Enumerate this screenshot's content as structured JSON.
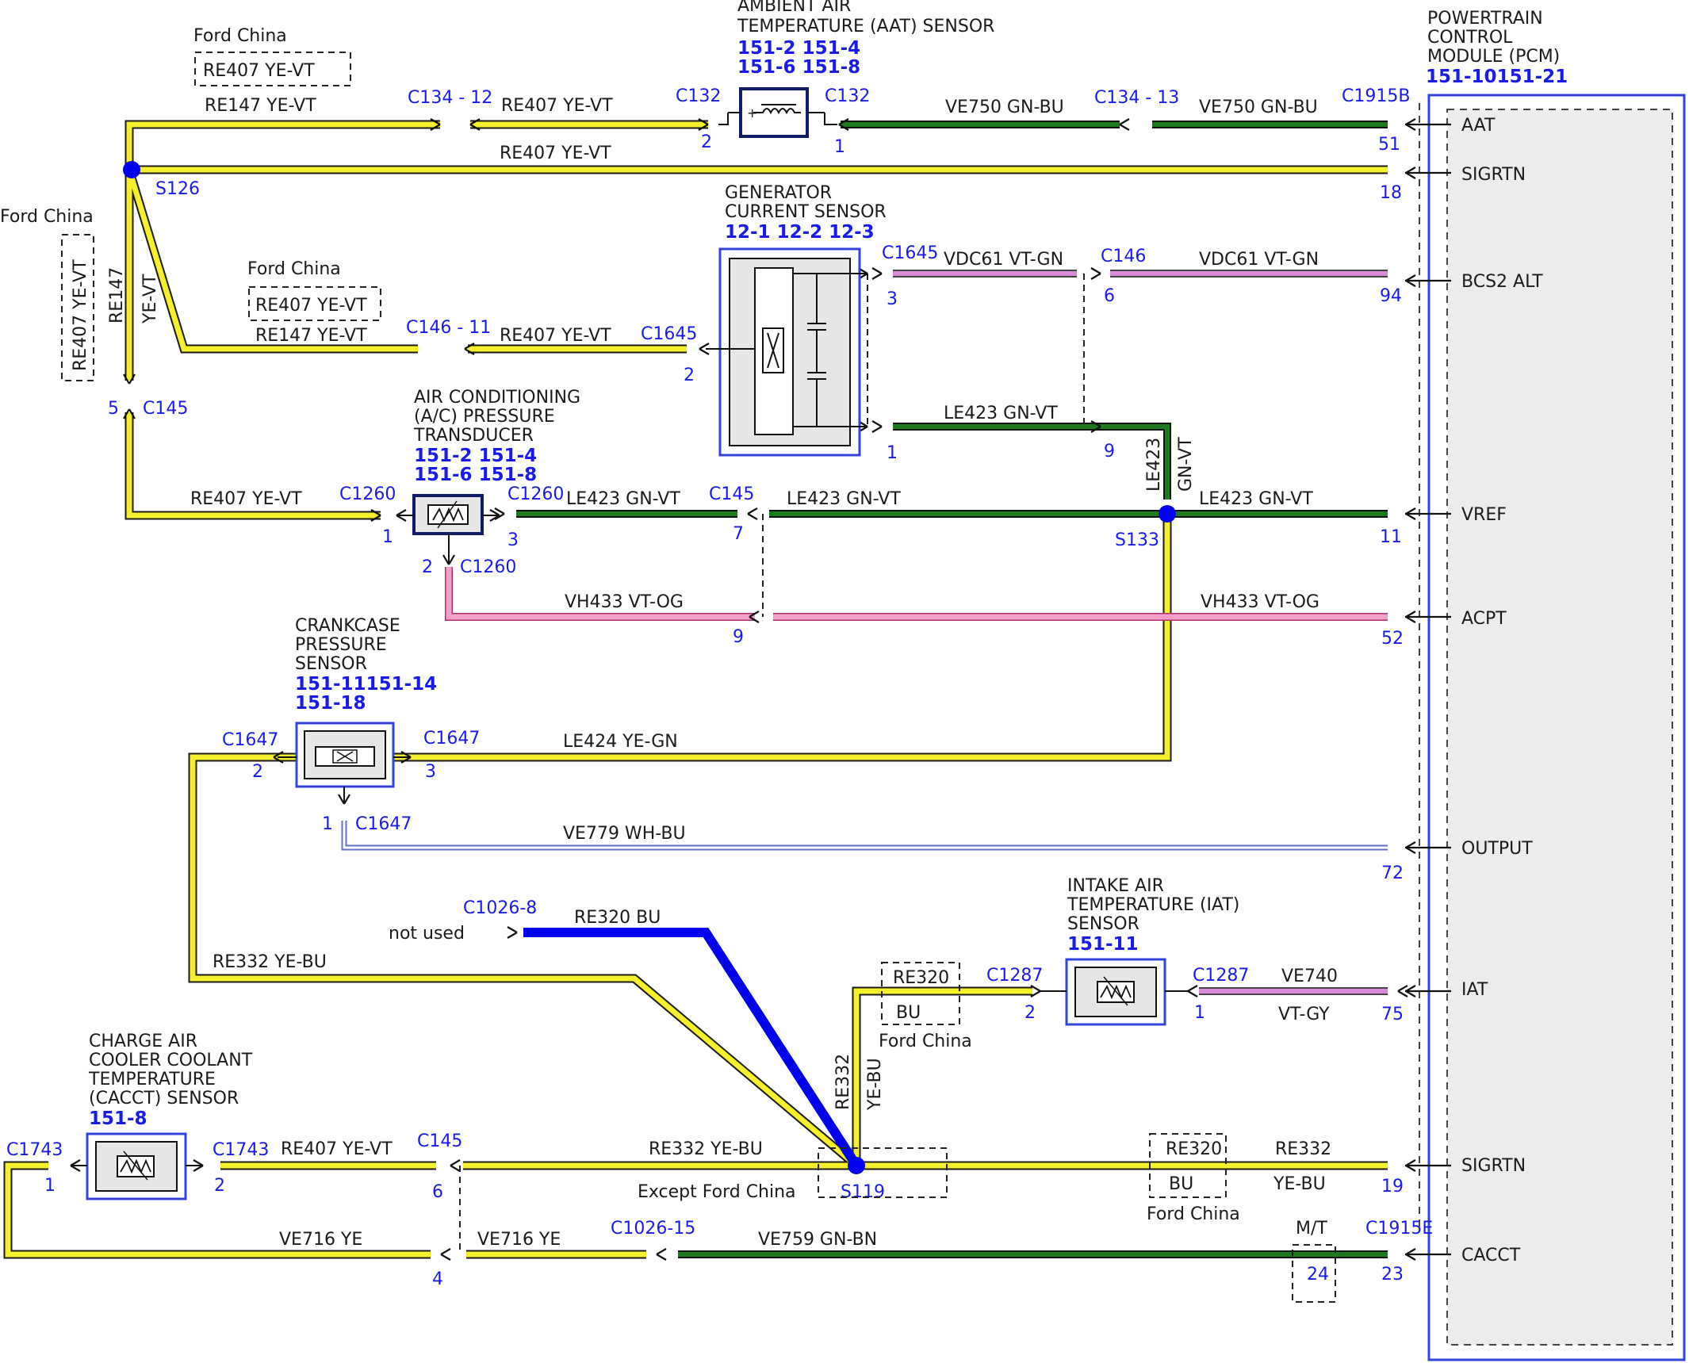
{
  "pcm": {
    "title": [
      "POWERTRAIN",
      "CONTROL",
      "MODULE (PCM)"
    ],
    "refs": "151-10151-21",
    "connector": "C1915B",
    "connector2": "C1915E",
    "pins": [
      {
        "name": "AAT",
        "pin": "51"
      },
      {
        "name": "SIGRTN",
        "pin": "18"
      },
      {
        "name": "BCS2 ALT",
        "pin": "94"
      },
      {
        "name": "VREF",
        "pin": "11"
      },
      {
        "name": "ACPT",
        "pin": "52"
      },
      {
        "name": "OUTPUT",
        "pin": "72"
      },
      {
        "name": "IAT",
        "pin": "75"
      },
      {
        "name": "SIGRTN",
        "pin": "19"
      },
      {
        "name": "CACCT",
        "pin": "23"
      }
    ]
  },
  "components": {
    "aat": {
      "title": [
        "AMBIENT AIR",
        "TEMPERATURE (AAT) SENSOR"
      ],
      "refs": [
        "151-2 151-4",
        "151-6 151-8"
      ],
      "conn_left": "C132",
      "conn_right": "C132",
      "pin_left": "2",
      "pin_right": "1"
    },
    "gen": {
      "title": [
        "GENERATOR",
        "CURRENT SENSOR"
      ],
      "refs": "12-1  12-2  12-3",
      "conn_a": "C1645",
      "conn_b": "C1645",
      "pin_3": "3",
      "pin_1": "1",
      "pin_2": "2"
    },
    "acpt": {
      "title": [
        "AIR CONDITIONING",
        "(A/C) PRESSURE",
        "TRANSDUCER"
      ],
      "refs": [
        "151-2 151-4",
        "151-6 151-8"
      ],
      "conn_left": "C1260",
      "conn_right": "C1260",
      "conn_bottom": "C1260",
      "pin_1": "1",
      "pin_3": "3",
      "pin_2": "2"
    },
    "ccp": {
      "title": [
        "CRANKCASE",
        "PRESSURE",
        "SENSOR"
      ],
      "refs": [
        "151-11151-14",
        "151-18"
      ],
      "conn_left": "C1647",
      "conn_right": "C1647",
      "conn_bottom": "C1647",
      "pin_2": "2",
      "pin_3": "3",
      "pin_1": "1"
    },
    "iat": {
      "title": [
        "INTAKE AIR",
        "TEMPERATURE (IAT)",
        "SENSOR"
      ],
      "refs": "151-11",
      "conn_left": "C1287",
      "conn_right": "C1287",
      "pin_2": "2",
      "pin_1": "1"
    },
    "cacct": {
      "title": [
        "CHARGE AIR",
        "COOLER COOLANT",
        "TEMPERATURE",
        "(CACCT) SENSOR"
      ],
      "refs": "151-8",
      "conn_left": "C1743",
      "conn_right": "C1743",
      "pin_1": "1",
      "pin_2": "2"
    }
  },
  "connectors": {
    "c134_12": "C134 - 12",
    "c134_13": "C134 - 13",
    "c146_11": "C146 - 11",
    "c146": "C146",
    "c146_pin6": "6",
    "c146_pin9": "9",
    "c145_top": "C145",
    "c145_top_pin": "5",
    "c145_mid": "C145",
    "c145_mid_pin7": "7",
    "c145_mid_pin9": "9",
    "c145_bot": "C145",
    "c145_bot_pin6": "6",
    "c145_bot_pin4": "4",
    "c1026_8": "C1026-8",
    "c1026_15": "C1026-15",
    "mt": "M/T",
    "mt_pin": "24"
  },
  "splices": {
    "s126": "S126",
    "s133": "S133",
    "s119": "S119"
  },
  "wires": {
    "re147_top": "RE147   YE-VT",
    "re407_top": "RE407   YE-VT",
    "re407_box": "RE407   YE-VT",
    "ve750_a": "VE750   GN-BU",
    "ve750_b": "VE750   GN-BU",
    "re407_sigrtn": "RE407   YE-VT",
    "re147_vert_a": "RE147",
    "re147_vert_b": "YE-VT",
    "re407_vert_box": "RE407  YE-VT",
    "re407_box2": "RE407  YE-VT",
    "re147_mid": "RE147   YE-VT",
    "re407_mid": "RE407    YE-VT",
    "vdc61_a": "VDC61    VT-GN",
    "vdc61_b": "VDC61    VT-GN",
    "le423_a": "LE423     GN-VT",
    "le423_vert_a": "LE423",
    "le423_vert_b": "GN-VT",
    "re407_acpt": "RE407    YE-VT",
    "le423_b": "LE423     GN-VT",
    "le423_c": "LE423      GN-VT",
    "le423_d": "LE423     GN-VT",
    "vh433_a": "VH433    VT-OG",
    "vh433_b": "VH433    VT-OG",
    "le424": "LE424      YE-GN",
    "ve779": "VE779      WH-BU",
    "re320_bu": "RE320      BU",
    "not_used": "not used",
    "re332_left": "RE332      YE-BU",
    "re320_box_a": "RE320",
    "re320_box_b": "BU",
    "re332_vert_a": "RE332",
    "re332_vert_b": "YE-BU",
    "ve740_a": "VE740",
    "ve740_b": "VT-GY",
    "re407_cacct": "RE407       YE-VT",
    "re332_mid": "RE332      YE-BU",
    "re320_box2_a": "RE320",
    "re320_box2_b": "BU",
    "re332_right_a": "RE332",
    "re332_right_b": "YE-BU",
    "ve716_a": "VE716    YE",
    "ve716_b": "VE716      YE",
    "ve759": "VE759      GN-BN"
  },
  "notes": {
    "ford_china": "Ford China",
    "except_ford_china": "Except Ford China"
  },
  "colors": {
    "yellow": "#f5f02a",
    "green": "#1e7a1e",
    "violet": "#d98ad9",
    "pink": "#f2a0c8",
    "blue": "#0000ee",
    "module_border": "#3344dd"
  }
}
